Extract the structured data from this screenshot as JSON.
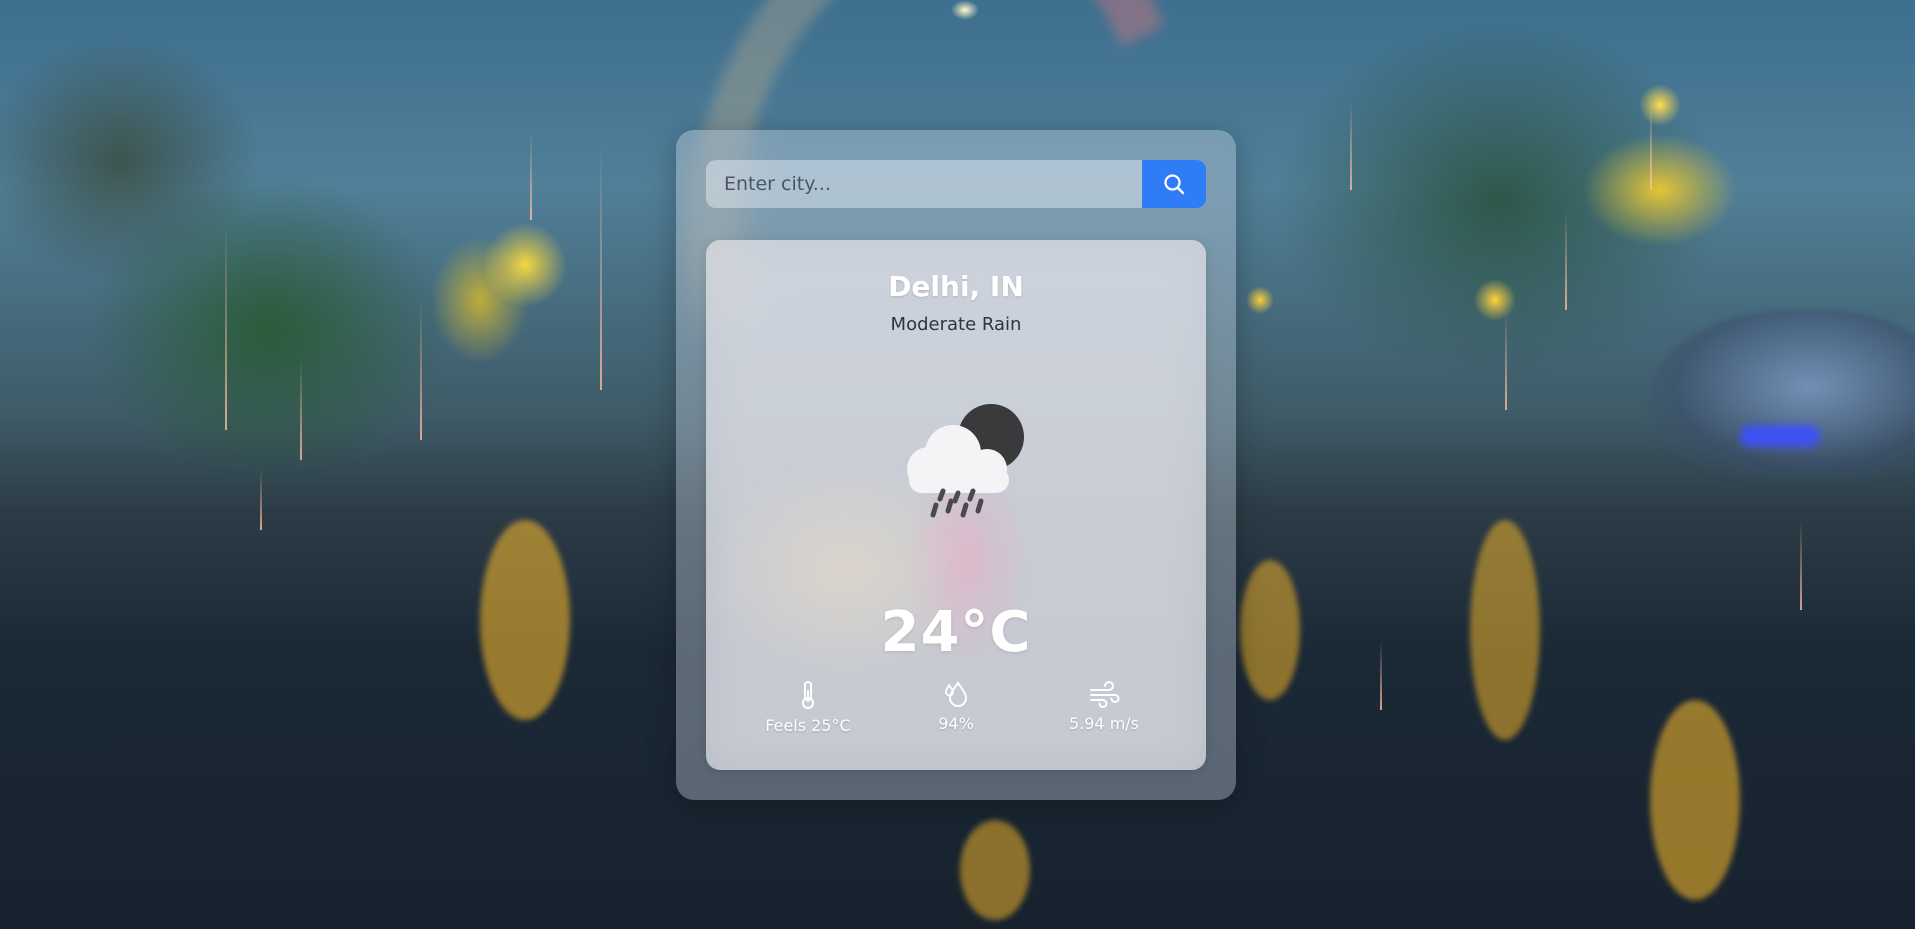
{
  "search": {
    "placeholder": "Enter city...",
    "button_icon": "search-icon"
  },
  "weather": {
    "location": "Delhi, IN",
    "condition": "Moderate Rain",
    "icon": "cloud-rain-moon-icon",
    "temperature": "24°C",
    "stats": [
      {
        "icon": "thermometer-icon",
        "label": "Feels 25°C"
      },
      {
        "icon": "humidity-drops-icon",
        "label": "94%"
      },
      {
        "icon": "wind-icon",
        "label": "5.94 m/s"
      }
    ]
  },
  "colors": {
    "accent": "#2f7cf6",
    "text_light": "#ffffff",
    "text_dark": "#303340"
  }
}
